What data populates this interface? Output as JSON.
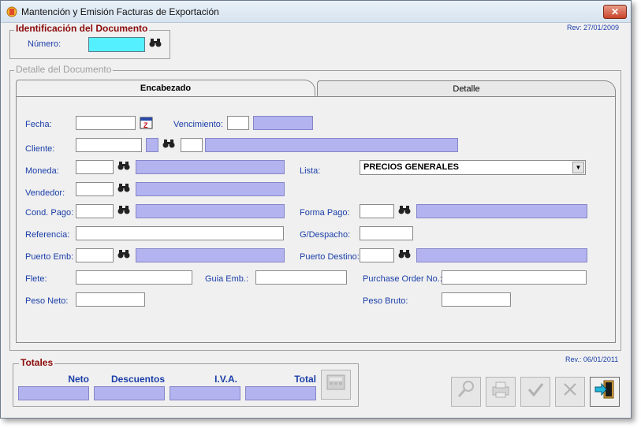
{
  "window": {
    "title": "Mantención y Emisión Facturas de Exportación",
    "close_label": "✕"
  },
  "rev_top": "Rev: 27/01/2009",
  "rev_bottom": "Rev.: 06/01/2011",
  "identificacion": {
    "legend": "Identificación del Documento",
    "numero_label": "Número:",
    "numero_value": ""
  },
  "detalle": {
    "legend": "Detalle del Documento",
    "tabs": [
      {
        "label": "Encabezado"
      },
      {
        "label": "Detalle"
      }
    ]
  },
  "form": {
    "fecha": "Fecha:",
    "vencimiento": "Vencimiento:",
    "cliente": "Cliente:",
    "moneda": "Moneda:",
    "lista": "Lista:",
    "lista_value": "PRECIOS GENERALES",
    "vendedor": "Vendedor:",
    "cond_pago": "Cond. Pago:",
    "forma_pago": "Forma Pago:",
    "referencia": "Referencia:",
    "g_despacho": "G/Despacho:",
    "puerto_emb": "Puerto Emb:",
    "puerto_destino": "Puerto Destino:",
    "flete": "Flete:",
    "guia_emb": "Guia Emb.:",
    "purchase_order": "Purchase Order No.:",
    "peso_neto": "Peso Neto:",
    "peso_bruto": "Peso Bruto:"
  },
  "totales": {
    "legend": "Totales",
    "headers": [
      "Neto",
      "Descuentos",
      "I.V.A.",
      "Total"
    ]
  },
  "icons": {
    "binoculars": "🔭",
    "calendar": "calendar-icon",
    "dropdown": "▼"
  },
  "colors": {
    "readonly_fill": "#b3b3f0",
    "focus_fill": "#55f0ff",
    "label_blue": "#1a3ea8",
    "legend_maroon": "#8b0a0a"
  }
}
